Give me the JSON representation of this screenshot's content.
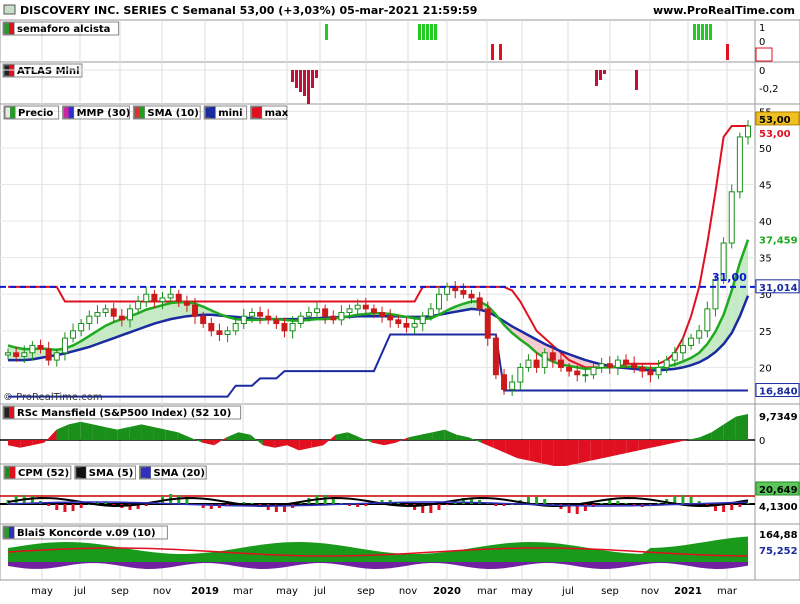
{
  "header": {
    "title": "DISCOVERY INC. SERIES C Semanal 53,00 (+3,03%) 05-mar-2021 21:59:59",
    "source": "www.ProRealTime.com"
  },
  "watermark": "© ProRealTime.com",
  "x_axis": {
    "labels": [
      "may",
      "jul",
      "sep",
      "nov",
      "2019",
      "mar",
      "may",
      "jul",
      "sep",
      "nov",
      "2020",
      "mar",
      "may",
      "jul",
      "sep",
      "nov",
      "2021",
      "mar"
    ]
  },
  "panels": {
    "semaforo": {
      "legend": "semaforo alcista",
      "ticks": [
        "1",
        "0",
        "-1"
      ]
    },
    "atlas": {
      "legend": "ATLAS Mini",
      "ticks": [
        "0",
        "-0,2"
      ]
    },
    "price": {
      "legend": [
        "Precio",
        "MMP (30)",
        "SMA (10)",
        "mini",
        "max"
      ],
      "ticks": [
        "55",
        "50",
        "45",
        "40",
        "35",
        "30",
        "25",
        "20"
      ],
      "badges": {
        "last": "53,00",
        "max": "53,00",
        "sma10": "37,459",
        "dashed": "31,014",
        "mini": "16,840"
      },
      "line_label": "31,00"
    },
    "rsc": {
      "legend": "RSc Mansfield (S&P500 Index) (52 10)",
      "ticks": [
        "0"
      ],
      "badge": "9,7349"
    },
    "cpm": {
      "legend": [
        "CPM (52)",
        "SMA (5)",
        "SMA (20)"
      ],
      "badges": [
        "20,649",
        "4,1300"
      ]
    },
    "koncorde": {
      "legend": "BlaiS Koncorde v.09 (10)",
      "badges": [
        "164,88",
        "75,252"
      ]
    }
  },
  "colors": {
    "green": "#1faa1f",
    "red": "#e01020",
    "navy": "#1a2aa0",
    "dash": "#0a1acc",
    "candle_up": "#1a8f1a",
    "candle_dn": "#cc1a1a"
  },
  "chart_data": {
    "type": "candlestick",
    "title": "DISCOVERY INC. SERIES C Semanal 53,00 (+3,03%) 05-mar-2021 21:59:59",
    "x": [
      "may",
      "jul",
      "sep",
      "nov",
      "2019",
      "mar",
      "may",
      "jul",
      "sep",
      "nov",
      "2020",
      "mar",
      "may",
      "jul",
      "sep",
      "nov",
      "2021",
      "mar"
    ],
    "ylim": [
      15,
      56
    ],
    "last_close": 53.0,
    "close_series": [
      22,
      21.5,
      22,
      23,
      22.5,
      21,
      22,
      24,
      25,
      26,
      27,
      27.5,
      28,
      27,
      26.5,
      28,
      29,
      30,
      29,
      29.5,
      30,
      29,
      28.5,
      27,
      26,
      25,
      24.5,
      25,
      26,
      27,
      27.5,
      27,
      26.5,
      26,
      25,
      26,
      27,
      27.5,
      28,
      27,
      26.5,
      27.5,
      28,
      28.5,
      28,
      27.5,
      27,
      26.5,
      26,
      25.5,
      26,
      27,
      28,
      30,
      31,
      30.5,
      30,
      29.5,
      28,
      24,
      19,
      17,
      18,
      20,
      21,
      20,
      22,
      21,
      20,
      19.5,
      19,
      19,
      20,
      20.5,
      20,
      21,
      20.5,
      20,
      19.5,
      19,
      20,
      21,
      22,
      23,
      24,
      25,
      28,
      32,
      37,
      44,
      51.5,
      53
    ],
    "series": [
      {
        "name": "SMA (10)",
        "values": [
          23,
          22.7,
          22.5,
          22.5,
          22.6,
          22.5,
          22.4,
          22.6,
          23,
          23.6,
          24.3,
          25,
          25.7,
          26.2,
          26.6,
          27,
          27.4,
          27.9,
          28.2,
          28.5,
          28.8,
          28.9,
          28.9,
          28.7,
          28.3,
          27.8,
          27.3,
          26.9,
          26.6,
          26.5,
          26.5,
          26.5,
          26.6,
          26.6,
          26.5,
          26.4,
          26.4,
          26.5,
          26.6,
          26.6,
          26.7,
          26.8,
          27,
          27.2,
          27.3,
          27.4,
          27.4,
          27.3,
          27.1,
          26.9,
          26.7,
          26.6,
          26.7,
          27.2,
          27.8,
          28.3,
          28.7,
          29,
          29,
          28.4,
          27.2,
          25.8,
          24.7,
          23.8,
          23,
          22,
          21.3,
          20.8,
          20.4,
          20.2,
          20,
          19.8,
          19.9,
          20,
          20,
          20.1,
          20.1,
          20.1,
          20,
          19.9,
          19.9,
          20.1,
          20.4,
          20.8,
          21.3,
          22,
          23.2,
          24.9,
          27.2,
          30.5,
          34.3,
          37.459
        ]
      },
      {
        "name": "MMP (30)",
        "values": [
          21,
          21,
          21,
          21.1,
          21.3,
          21.5,
          21.7,
          21.9,
          22.2,
          22.5,
          22.8,
          23.2,
          23.6,
          24,
          24.4,
          24.8,
          25.2,
          25.6,
          26,
          26.3,
          26.6,
          26.8,
          27,
          27.1,
          27.2,
          27.2,
          27.1,
          27,
          26.9,
          26.8,
          26.7,
          26.6,
          26.6,
          26.6,
          26.6,
          26.6,
          26.6,
          26.7,
          26.7,
          26.8,
          26.8,
          26.9,
          26.9,
          27,
          27,
          27,
          27,
          27,
          27,
          26.9,
          26.9,
          26.9,
          27,
          27.2,
          27.4,
          27.6,
          27.8,
          28,
          27.9,
          27.6,
          27,
          26.3,
          25.6,
          25,
          24.4,
          23.8,
          23.2,
          22.7,
          22.2,
          21.8,
          21.4,
          21,
          20.7,
          20.4,
          20.2,
          20,
          19.9,
          19.8,
          19.7,
          19.6,
          19.6,
          19.7,
          19.8,
          20,
          20.3,
          20.7,
          21.3,
          22.1,
          23.2,
          24.7,
          27,
          29.8
        ]
      },
      {
        "name": "max",
        "values": [
          31,
          31,
          31,
          31,
          31,
          31,
          31,
          29,
          29,
          29,
          29,
          29,
          29,
          29,
          29,
          29,
          29,
          29,
          29,
          29,
          29,
          29,
          29,
          29,
          29,
          29,
          29,
          29,
          29,
          29,
          29,
          29,
          29,
          29,
          29,
          29,
          29,
          29,
          29,
          29,
          29,
          29,
          29,
          29,
          29,
          29,
          29,
          29,
          29,
          29,
          29,
          31,
          31,
          31,
          31,
          31,
          31,
          31,
          31,
          31,
          31,
          31,
          30.5,
          29,
          27,
          25,
          24,
          23,
          22,
          21,
          20.5,
          20,
          20,
          20,
          20,
          20,
          20.5,
          20.5,
          20.5,
          20.5,
          20.5,
          21,
          22,
          24,
          27,
          31,
          37,
          44,
          51.5,
          53,
          53,
          53
        ]
      },
      {
        "name": "mini",
        "values": [
          16,
          16,
          16,
          16,
          16,
          16,
          16,
          16,
          16,
          16,
          16,
          16,
          16,
          16,
          16,
          16,
          16,
          16,
          16,
          16,
          16,
          16,
          16,
          16,
          16,
          16,
          16,
          16,
          17.5,
          17.5,
          17.5,
          18.5,
          18.5,
          18.5,
          19.5,
          19.5,
          19.5,
          19.5,
          19.5,
          19.5,
          19.5,
          19.5,
          19.5,
          19.5,
          19.5,
          19.5,
          22,
          24.5,
          24.5,
          24.5,
          24.5,
          24.5,
          24.5,
          24.5,
          24.5,
          24.5,
          24.5,
          24.5,
          24.5,
          24.5,
          24.5,
          16.84,
          16.84,
          16.84,
          16.84,
          16.84,
          16.84,
          16.84,
          16.84,
          16.84,
          16.84,
          16.84,
          16.84,
          16.84,
          16.84,
          16.84,
          16.84,
          16.84,
          16.84,
          16.84,
          16.84,
          16.84,
          16.84,
          16.84,
          16.84,
          16.84,
          16.84,
          16.84,
          16.84,
          16.84,
          16.84,
          16.84
        ]
      }
    ],
    "hline": 31.014,
    "ylabel": ""
  }
}
